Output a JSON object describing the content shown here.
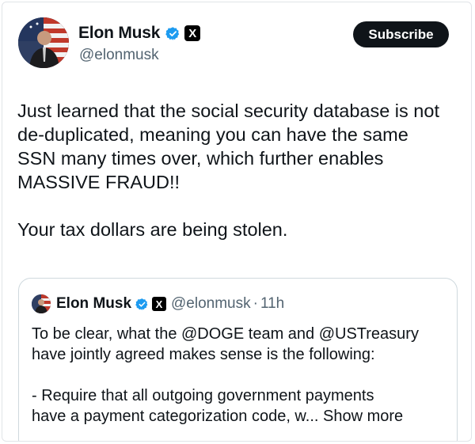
{
  "tweet": {
    "author_name": "Elon Musk",
    "author_handle": "@elonmusk",
    "subscribe_label": "Subscribe",
    "x_badge": "X",
    "text": "Just learned that the social security database is not\nde-duplicated, meaning you can have the same\nSSN many times over, which further enables\nMASSIVE FRAUD!!\n\nYour tax dollars are being stolen."
  },
  "quote": {
    "author_name": "Elon Musk",
    "x_badge": "X",
    "author_handle": "@elonmusk",
    "separator": "·",
    "time": "11h",
    "text": "To be clear, what the @DOGE team and @USTreasury\nhave jointly agreed makes sense is the following:\n\n- Require that all outgoing government payments\nhave a payment categorization code, w... ",
    "show_more_label": "Show more"
  },
  "colors": {
    "verified": "#1d9bf0",
    "text_primary": "#0f1419",
    "text_secondary": "#536471",
    "button_bg": "#0f1419",
    "border": "#cfd9de"
  },
  "icons": {
    "verified": "verified-check-icon",
    "x_logo": "x-logo-icon"
  }
}
